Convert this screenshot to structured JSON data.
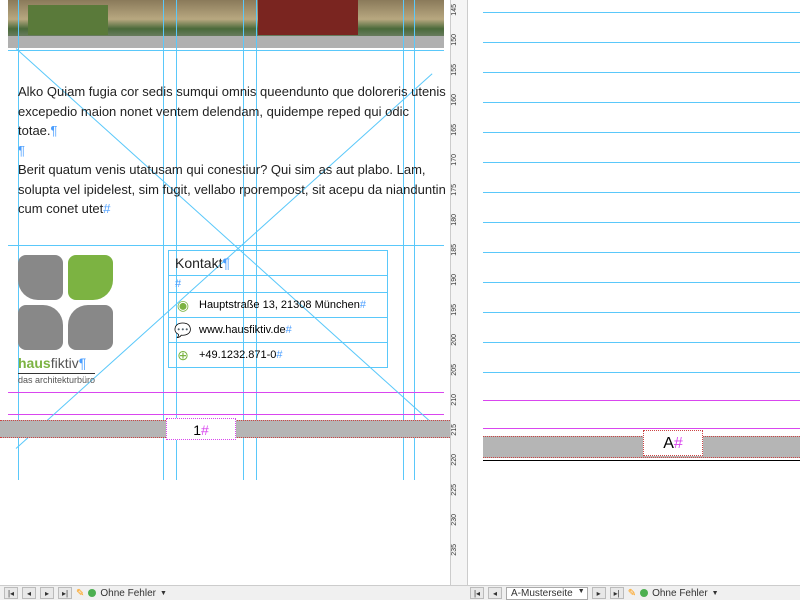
{
  "body": {
    "para1": "Alko Quiam fugia cor sedis sumqui omnis queendunto que doloreris utenis excepedio maion nonet ventem delendam, quidempe reped qui odic totae.",
    "para2": "Berit quatum venis utatusam qui conestiur? Qui sim as aut plabo. Lam, solupta vel ipidelest, sim fugit, vellabo rporempost, sit acepu da nianduntin cum conet utet"
  },
  "contact": {
    "heading": "Kontakt",
    "address": "Hauptstraße 13, 21308 München",
    "web": "www.hausfiktiv.de",
    "phone": "+49.1232.871-0"
  },
  "logo": {
    "brand1": "haus",
    "brand2": "fiktiv",
    "tagline": "das architekturbüro"
  },
  "page_left": "1",
  "page_right": "A",
  "ruler_ticks": [
    "145",
    "150",
    "155",
    "160",
    "165",
    "170",
    "175",
    "180",
    "185",
    "190",
    "195",
    "200",
    "205",
    "210",
    "215",
    "220",
    "225",
    "230",
    "235"
  ],
  "status": {
    "errors": "Ohne Fehler",
    "master": "A-Musterseite"
  }
}
